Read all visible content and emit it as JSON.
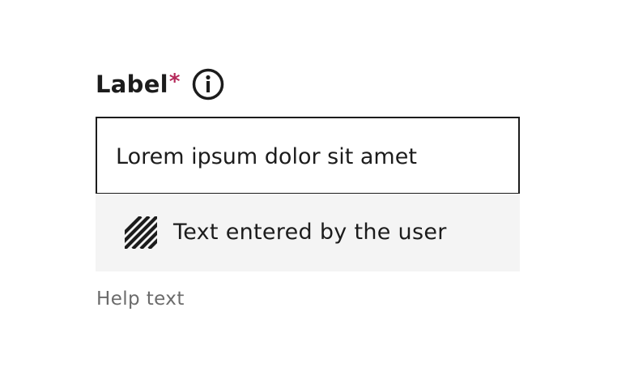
{
  "field": {
    "label": "Label",
    "required_marker": "*",
    "info_icon": "info-icon",
    "input_value": "Lorem ipsum dolor sit amet",
    "help_text": "Help text"
  },
  "annotation": {
    "swatch_icon": "hatch-pattern-icon",
    "text": "Text entered by the user"
  },
  "colors": {
    "text": "#1c1c1c",
    "required": "#b5295a",
    "help_text": "#6b6b6b",
    "annotation_background": "#f4f4f4",
    "input_border": "#1c1c1c"
  }
}
